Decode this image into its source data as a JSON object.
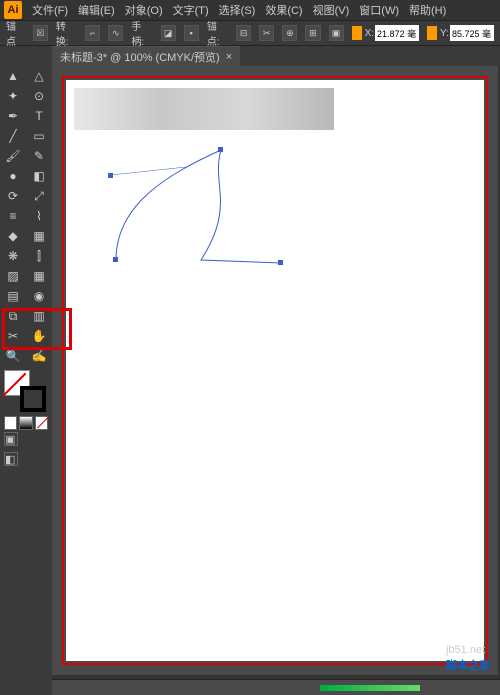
{
  "app": {
    "logo_text": "Ai"
  },
  "menu": {
    "file": "文件(F)",
    "edit": "编辑(E)",
    "object": "对象(O)",
    "type": "文字(T)",
    "select": "选择(S)",
    "effect": "效果(C)",
    "view": "视图(V)",
    "window": "窗口(W)",
    "help": "帮助(H)"
  },
  "ctrlbar": {
    "anchor_label": "锚点",
    "convert_label": "转换:",
    "handle_label": "手柄:",
    "anchor2_label": "锚点:",
    "x_label": "X:",
    "x_value": "21.872 毫",
    "y_label": "Y:",
    "y_value": "85.725 毫"
  },
  "tab": {
    "title": "未标题-3* @ 100% (CMYK/预览)",
    "close": "×"
  },
  "tools": {
    "row0": [
      "sel",
      "dir"
    ],
    "row1": [
      "wand",
      "lasso"
    ],
    "row2": [
      "pen",
      "type"
    ],
    "row3": [
      "line",
      "rect"
    ],
    "row4": [
      "brush",
      "pencil"
    ],
    "row5": [
      "blob",
      "eraser"
    ],
    "row6": [
      "rotate",
      "scale"
    ],
    "row7": [
      "width",
      "warp"
    ],
    "row8": [
      "shaper",
      "shape"
    ],
    "row9": [
      "sym",
      "graph"
    ],
    "row10": [
      "art",
      "mesh"
    ],
    "row11": [
      "grad",
      "eye"
    ],
    "row12": [
      "blend",
      "live"
    ],
    "row13": [
      "slice",
      "hand"
    ],
    "row14": [
      "zoom",
      "note"
    ]
  },
  "icons": {
    "sel": "▲",
    "dir": "△",
    "wand": "✦",
    "lasso": "⊙",
    "pen": "✒",
    "type": "T",
    "line": "╱",
    "rect": "▭",
    "brush": "🖌",
    "pencil": "✎",
    "blob": "●",
    "eraser": "◧",
    "rotate": "⟳",
    "scale": "⤢",
    "width": "≡",
    "warp": "⌇",
    "shaper": "◆",
    "shape": "▦",
    "sym": "❋",
    "graph": "⫿",
    "art": "▨",
    "mesh": "▦",
    "grad": "▤",
    "eye": "◉",
    "blend": "⧉",
    "live": "▥",
    "slice": "✂",
    "hand": "✋",
    "zoom": "🔍",
    "note": "✍"
  },
  "modes": {
    "fill": "□",
    "grad": "▤",
    "none": "☒"
  },
  "watermark": {
    "url": "jb51.net",
    "cn": "脚本之家"
  },
  "colors": {
    "accent": "#d00",
    "artboard": "#fff",
    "stroke_path": "#3a5fcc"
  }
}
